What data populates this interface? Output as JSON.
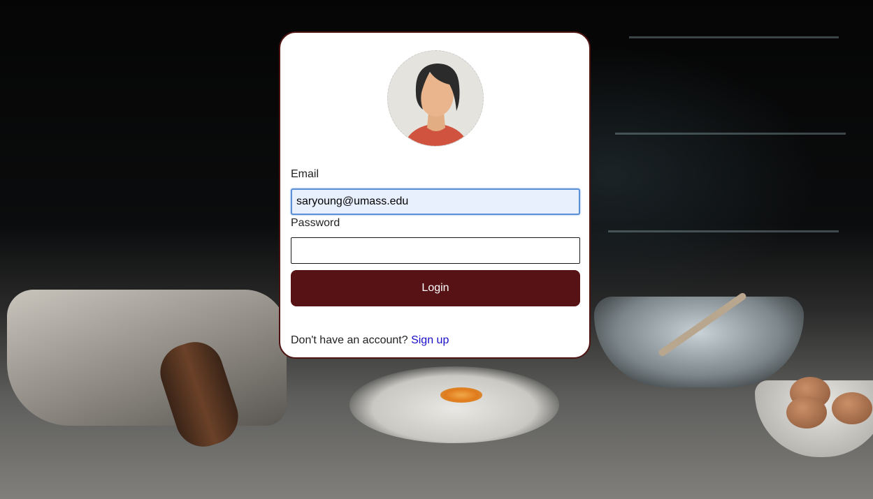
{
  "login_form": {
    "email_label": "Email",
    "email_value": "saryoung@umass.edu",
    "password_label": "Password",
    "password_value": "",
    "login_button_label": "Login",
    "signup_prompt": "Don't have an account?",
    "signup_link_label": "Sign up"
  },
  "avatar": {
    "icon": "user-avatar-icon"
  },
  "colors": {
    "card_border": "#4e1412",
    "login_button_bg": "#561214",
    "login_button_text": "#ffffff",
    "email_field_bg": "#e8f0fe",
    "email_field_focus_border": "#5b8fd6",
    "signup_link": "#1a0dcc"
  }
}
